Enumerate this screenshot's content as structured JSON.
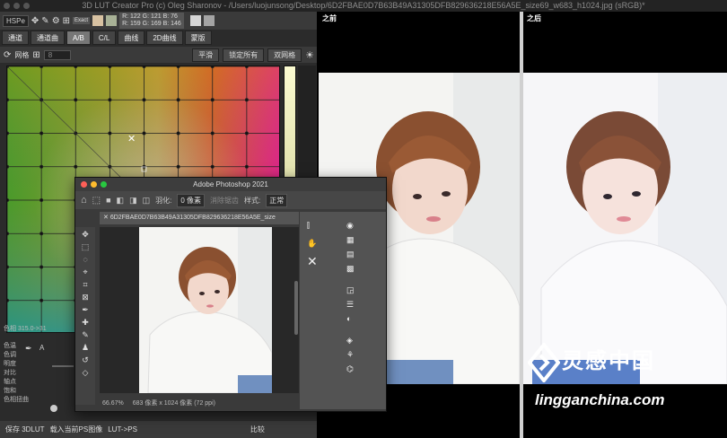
{
  "window": {
    "title": "3D LUT Creator Pro (c) Oleg Sharonov - /Users/luojunsong/Desktop/6D2FBAE0D7B63B49A31305DFB829636218E56A5E_size69_w683_h1024.jpg (sRGB)*"
  },
  "lut": {
    "colorspace": "HSPe",
    "exact_label": "Exact",
    "readout_line1": "R: 122  G: 121  B: 76",
    "readout_line2": "R: 159  G: 169  B: 146",
    "tabs": [
      "通道",
      "通道曲",
      "A/B",
      "C/L",
      "曲线",
      "2D曲线",
      "蒙版"
    ],
    "active_tab": "A/B",
    "grid_label": "网格",
    "grid_value": "8",
    "tool_buttons": [
      "平滑",
      "锁定所有",
      "双网格"
    ],
    "hue_range": "色相 315.0->31",
    "sliders": [
      "色温",
      "色调",
      "明度",
      "对比",
      "轴点",
      "饱和",
      "色相扭曲"
    ],
    "bottom_buttons": [
      "保存 3DLUT",
      "载入当前PS图像",
      "LUT->PS",
      "比较"
    ],
    "colors": {
      "panel": "#2b2b2b",
      "toolbar": "#3a3a3a"
    }
  },
  "compare": {
    "before_label": "之前",
    "after_label": "之后"
  },
  "photoshop": {
    "title": "Adobe Photoshop 2021",
    "feather_label": "羽化:",
    "feather_value": "0 像素",
    "refine_label": "消除锯齿",
    "style_label": "样式:",
    "style_value": "正常",
    "doc_tab": "6D2FBAE0D7B63B49A31305DFB829636218E56A5E_size",
    "zoom": "66.67%",
    "doc_info": "683 像素 x 1024 像素 (72 ppi)"
  },
  "watermark": {
    "cn": "灵感中国",
    "en": "lingganchina.com"
  }
}
